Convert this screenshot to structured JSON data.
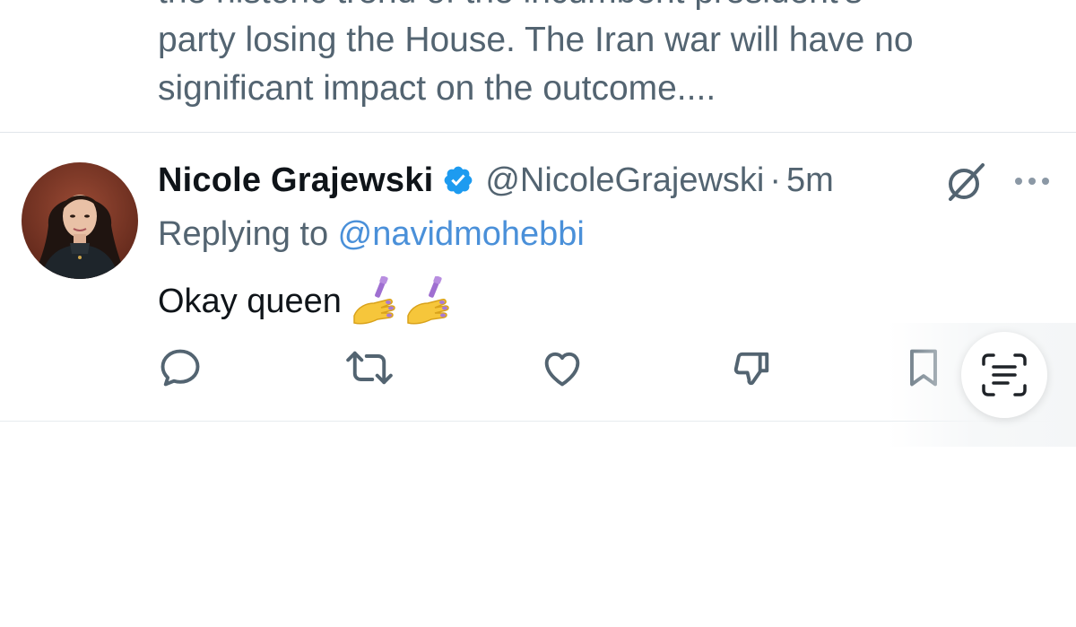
{
  "previous_tweet": {
    "text_lines": [
      "the historic trend of the incumbent president's",
      "party losing the House. The Iran war will have no",
      "significant impact on the outcome...."
    ]
  },
  "tweet": {
    "display_name": "Nicole Grajewski",
    "handle": "@NicoleGrajewski",
    "separator": "·",
    "time": "5m",
    "replying_prefix": "Replying to ",
    "replying_to": "@navidmohebbi",
    "body": "Okay queen",
    "emojis": [
      "nail-polish-emoji",
      "nail-polish-emoji"
    ]
  },
  "icons": {
    "verified": "verified-badge-icon",
    "grok": "grok-icon",
    "more": "more-options-icon",
    "reply": "reply-icon",
    "retweet": "retweet-icon",
    "like": "like-icon",
    "dislike": "dislike-icon",
    "bookmark": "bookmark-icon",
    "scan": "text-scan-icon"
  },
  "colors": {
    "primary_text": "#0f1419",
    "secondary_text": "#536471",
    "accent": "#1d9bf0",
    "mention": "#4a90d9",
    "divider": "#e1e6ea"
  }
}
